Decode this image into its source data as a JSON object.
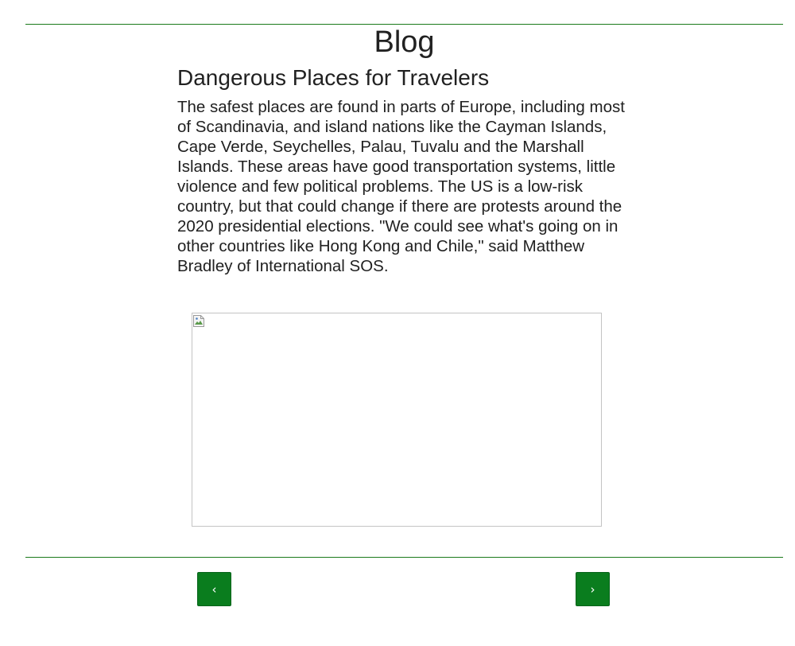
{
  "header": {
    "title": "Blog"
  },
  "article": {
    "title": "Dangerous Places for Travelers",
    "body": "The safest places are found in parts of Europe, including most of Scandinavia, and island nations like the Cayman Islands, Cape Verde, Seychelles, Palau, Tuvalu and the Marshall Islands. These areas have good transportation systems, little violence and few political problems. The US is a low-risk country, but that could change if there are protests around the 2020 presidential elections. \"We could see what's going on in other countries like Hong Kong and Chile,\" said Matthew Bradley of International SOS.",
    "image_icon": "broken-image-icon"
  },
  "pagination": {
    "prev_label": "‹",
    "next_label": "›"
  },
  "colors": {
    "accent": "#0a7d1e",
    "rule": "#1b7a1b",
    "text": "#212121"
  }
}
